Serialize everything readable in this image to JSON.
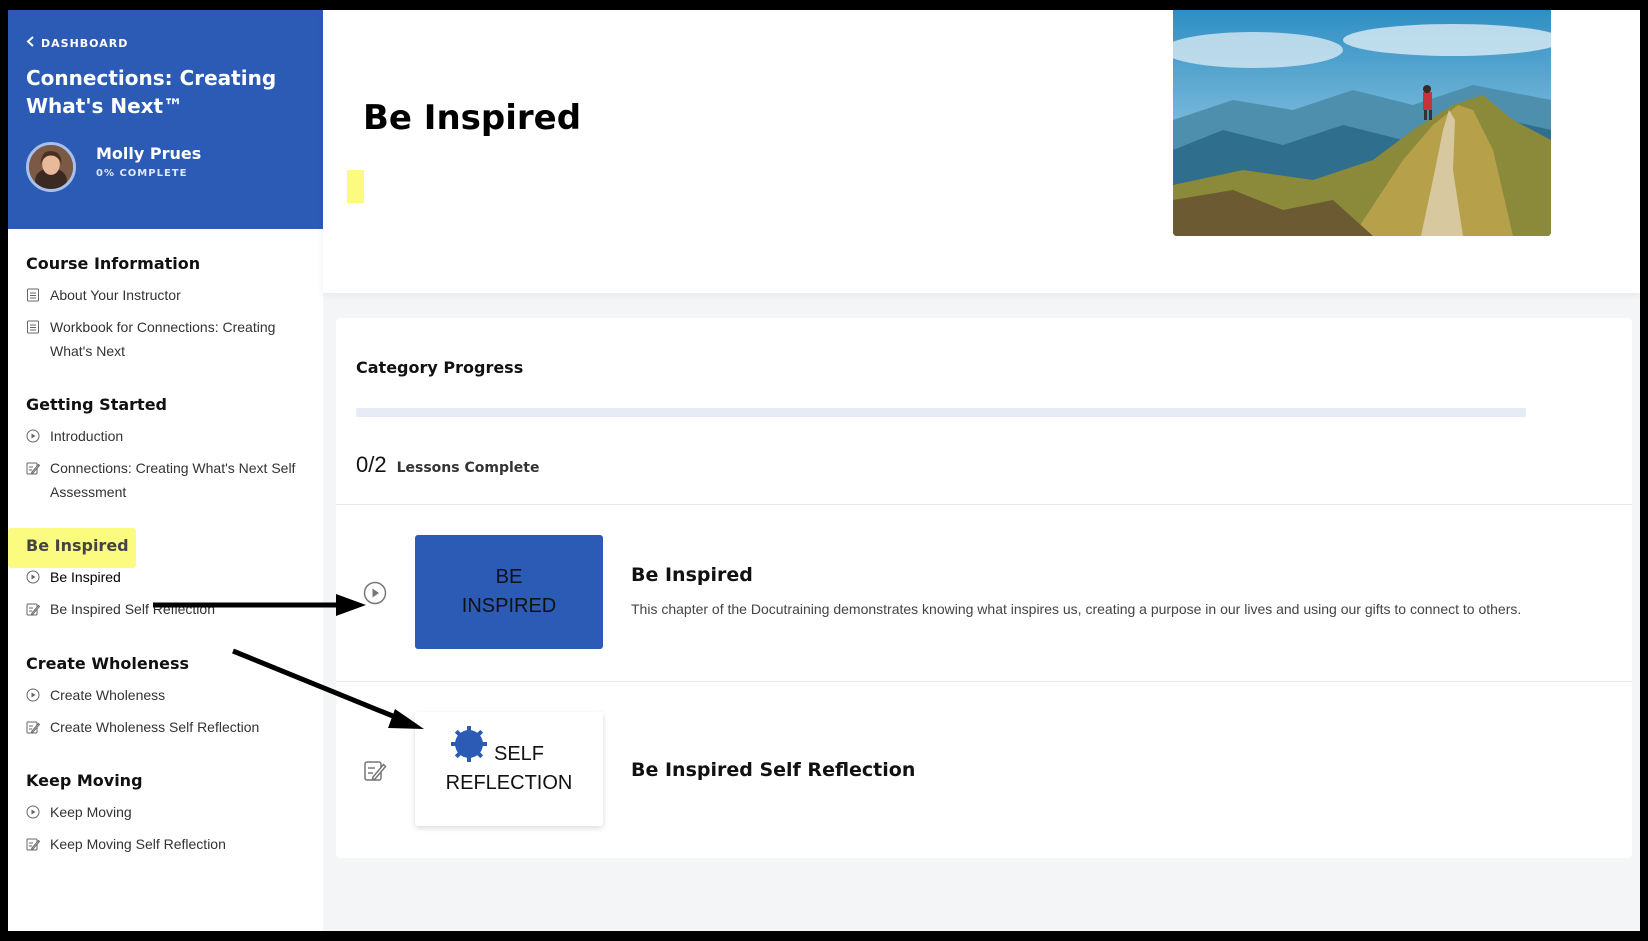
{
  "sidebar": {
    "back_label": "DASHBOARD",
    "course_title": "Connections: Creating What's Next™",
    "user_name": "Molly Prues",
    "user_progress": "0% COMPLETE",
    "sections": [
      {
        "title": "Course Information",
        "items": [
          {
            "label": "About Your Instructor",
            "icon": "document-icon"
          },
          {
            "label": "Workbook for Connections: Creating What's Next",
            "icon": "document-icon"
          }
        ]
      },
      {
        "title": "Getting Started",
        "items": [
          {
            "label": "Introduction",
            "icon": "play-circle-icon"
          },
          {
            "label": "Connections: Creating What's Next Self Assessment",
            "icon": "edit-form-icon"
          }
        ]
      },
      {
        "title": "Be Inspired",
        "items": [
          {
            "label": "Be Inspired",
            "icon": "play-circle-icon"
          },
          {
            "label": "Be Inspired Self Reflection",
            "icon": "edit-form-icon"
          }
        ]
      },
      {
        "title": "Create Wholeness",
        "items": [
          {
            "label": "Create Wholeness",
            "icon": "play-circle-icon"
          },
          {
            "label": "Create Wholeness Self Reflection",
            "icon": "edit-form-icon"
          }
        ]
      },
      {
        "title": "Keep Moving",
        "items": [
          {
            "label": "Keep Moving",
            "icon": "play-circle-icon"
          },
          {
            "label": "Keep Moving Self Reflection",
            "icon": "edit-form-icon"
          }
        ]
      }
    ]
  },
  "main": {
    "page_title": "Be Inspired",
    "progress": {
      "title": "Category Progress",
      "fraction": 0,
      "count": "0/2",
      "count_label": "Lessons Complete"
    },
    "lessons": [
      {
        "thumb_line1": "BE",
        "thumb_line2": "INSPIRED",
        "title": "Be Inspired",
        "description": "This chapter of the Docutraining demonstrates knowing what inspires us, creating a purpose in our lives and using our gifts to connect to others."
      },
      {
        "thumb_line1": "SELF",
        "thumb_line2": "REFLECTION",
        "title": "Be Inspired Self Reflection"
      }
    ]
  },
  "colors": {
    "brand_blue": "#2c5bb6",
    "highlight_yellow": "#fbfb7f"
  }
}
